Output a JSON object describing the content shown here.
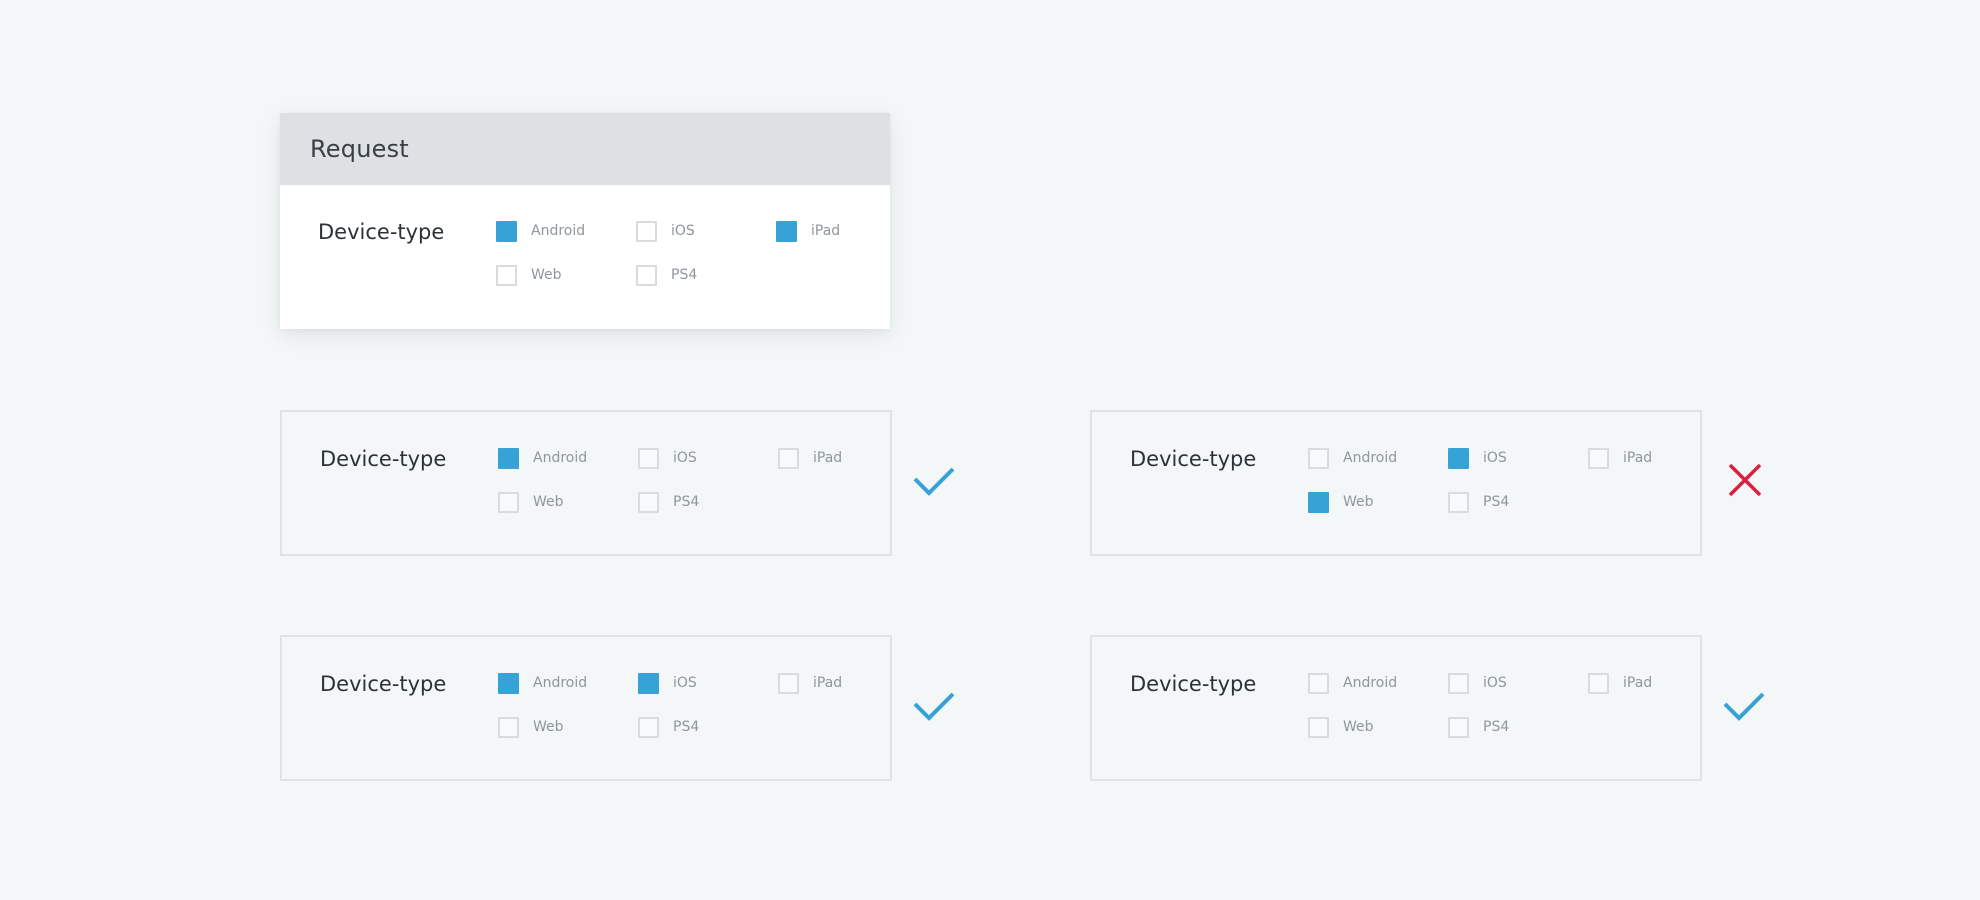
{
  "request": {
    "title": "Request",
    "field_label": "Device-type",
    "options": [
      {
        "label": "Android",
        "checked": true
      },
      {
        "label": "iOS",
        "checked": false
      },
      {
        "label": "iPad",
        "checked": true
      },
      {
        "label": "Web",
        "checked": false
      },
      {
        "label": "PS4",
        "checked": false
      }
    ]
  },
  "panels": [
    {
      "field_label": "Device-type",
      "verdict": "check-icon",
      "options": [
        {
          "label": "Android",
          "checked": true
        },
        {
          "label": "iOS",
          "checked": false
        },
        {
          "label": "iPad",
          "checked": false
        },
        {
          "label": "Web",
          "checked": false
        },
        {
          "label": "PS4",
          "checked": false
        }
      ]
    },
    {
      "field_label": "Device-type",
      "verdict": "cross-icon",
      "options": [
        {
          "label": "Android",
          "checked": false
        },
        {
          "label": "iOS",
          "checked": true
        },
        {
          "label": "iPad",
          "checked": false
        },
        {
          "label": "Web",
          "checked": true
        },
        {
          "label": "PS4",
          "checked": false
        }
      ]
    },
    {
      "field_label": "Device-type",
      "verdict": "check-icon",
      "options": [
        {
          "label": "Android",
          "checked": true
        },
        {
          "label": "iOS",
          "checked": true
        },
        {
          "label": "iPad",
          "checked": false
        },
        {
          "label": "Web",
          "checked": false
        },
        {
          "label": "PS4",
          "checked": false
        }
      ]
    },
    {
      "field_label": "Device-type",
      "verdict": "check-icon",
      "options": [
        {
          "label": "Android",
          "checked": false
        },
        {
          "label": "iOS",
          "checked": false
        },
        {
          "label": "iPad",
          "checked": false
        },
        {
          "label": "Web",
          "checked": false
        },
        {
          "label": "PS4",
          "checked": false
        }
      ]
    }
  ],
  "colors": {
    "accent": "#36a2d6",
    "check": "#36a2d6",
    "cross": "#d9213f",
    "background": "#f3f7f8",
    "header": "#dee1e3"
  }
}
